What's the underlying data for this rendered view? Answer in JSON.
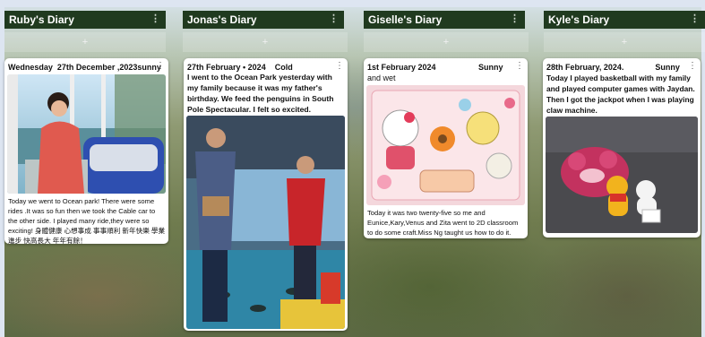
{
  "columns": [
    {
      "name": "Ruby's Diary",
      "card": {
        "title": "Wednesday  27th December ,2023sunny",
        "text": "Today we went to Ocean  park! There were some rides .It was so fun then we took the Cable car to the other side. I played many ride,they were so exciting! 身體健康 心想事成 事事順利 新年快樂 學業進步 快高長大 年年有餘！",
        "photo": "girl-in-cable-car-photo"
      }
    },
    {
      "name": "Jonas's Diary",
      "card": {
        "title": "27th February • 2024    Cold",
        "text": "         I went  to the Ocean Park yesterday with my family because it was my father's birthday. We feed the penguins in South Pole Spectacular. I felt so excited.",
        "photo": "penguin-feeding-photo"
      }
    },
    {
      "name": "Giselle's Diary",
      "card": {
        "title": "1st February 2024                   Sunny",
        "subtitle": "and wet",
        "text": "Today it was two twenty-five so me and Eunice,Kary,Venus and Zita went to 2D classroom to do some craft.Miss Ng taught us how to do it.",
        "photo": "sanrio-sticker-album-photo"
      }
    },
    {
      "name": "Kyle's Diary",
      "card": {
        "title": "28th February, 2024.              Sunny",
        "text": "       Today I played basketball with my family and played computer games with Jaydan. Then I got the jackpot when I was playing claw machine.",
        "photo": "claw-machine-plush-toys-photo"
      }
    }
  ],
  "ui": {
    "add_symbol": "+",
    "menu_symbol": "⋮"
  },
  "colors": {
    "header_bg": "#203a1f",
    "card_bg": "#ffffff"
  }
}
